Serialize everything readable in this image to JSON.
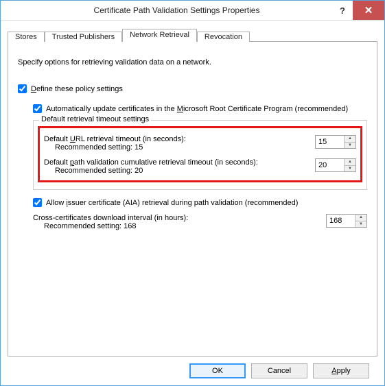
{
  "window": {
    "title": "Certificate Path Validation Settings Properties",
    "help_label": "?",
    "close_label": "✕"
  },
  "tabs": {
    "stores": "Stores",
    "trusted_publishers": "Trusted Publishers",
    "network_retrieval": "Network Retrieval",
    "revocation": "Revocation"
  },
  "panel": {
    "intro": "Specify options for retrieving validation data on a network.",
    "define_pre": "D",
    "define_post": "efine these policy settings",
    "auto_update_pre": "Automatically update certificates in the ",
    "auto_update_u": "M",
    "auto_update_post": "icrosoft Root Certificate Program (recommended)",
    "group_title": "Default retrieval timeout settings",
    "url_timeout_pre": "Default ",
    "url_timeout_u": "U",
    "url_timeout_post": "RL retrieval timeout (in seconds):",
    "url_timeout_rec": "Recommended setting: 15",
    "url_timeout_value": "15",
    "path_timeout_pre": "Default ",
    "path_timeout_u": "p",
    "path_timeout_post": "ath validation cumulative retrieval timeout (in seconds):",
    "path_timeout_rec": "Recommended setting: 20",
    "path_timeout_value": "20",
    "aia_pre": "Allow ",
    "aia_u": "i",
    "aia_post": "ssuer certificate (AIA) retrieval during path validation (recommended)",
    "cross_cert_label": "Cross-certificates download interval (in hours):",
    "cross_cert_rec": "Recommended setting: 168",
    "cross_cert_value": "168"
  },
  "buttons": {
    "ok": "OK",
    "cancel": "Cancel",
    "apply_u": "A",
    "apply_post": "pply"
  }
}
